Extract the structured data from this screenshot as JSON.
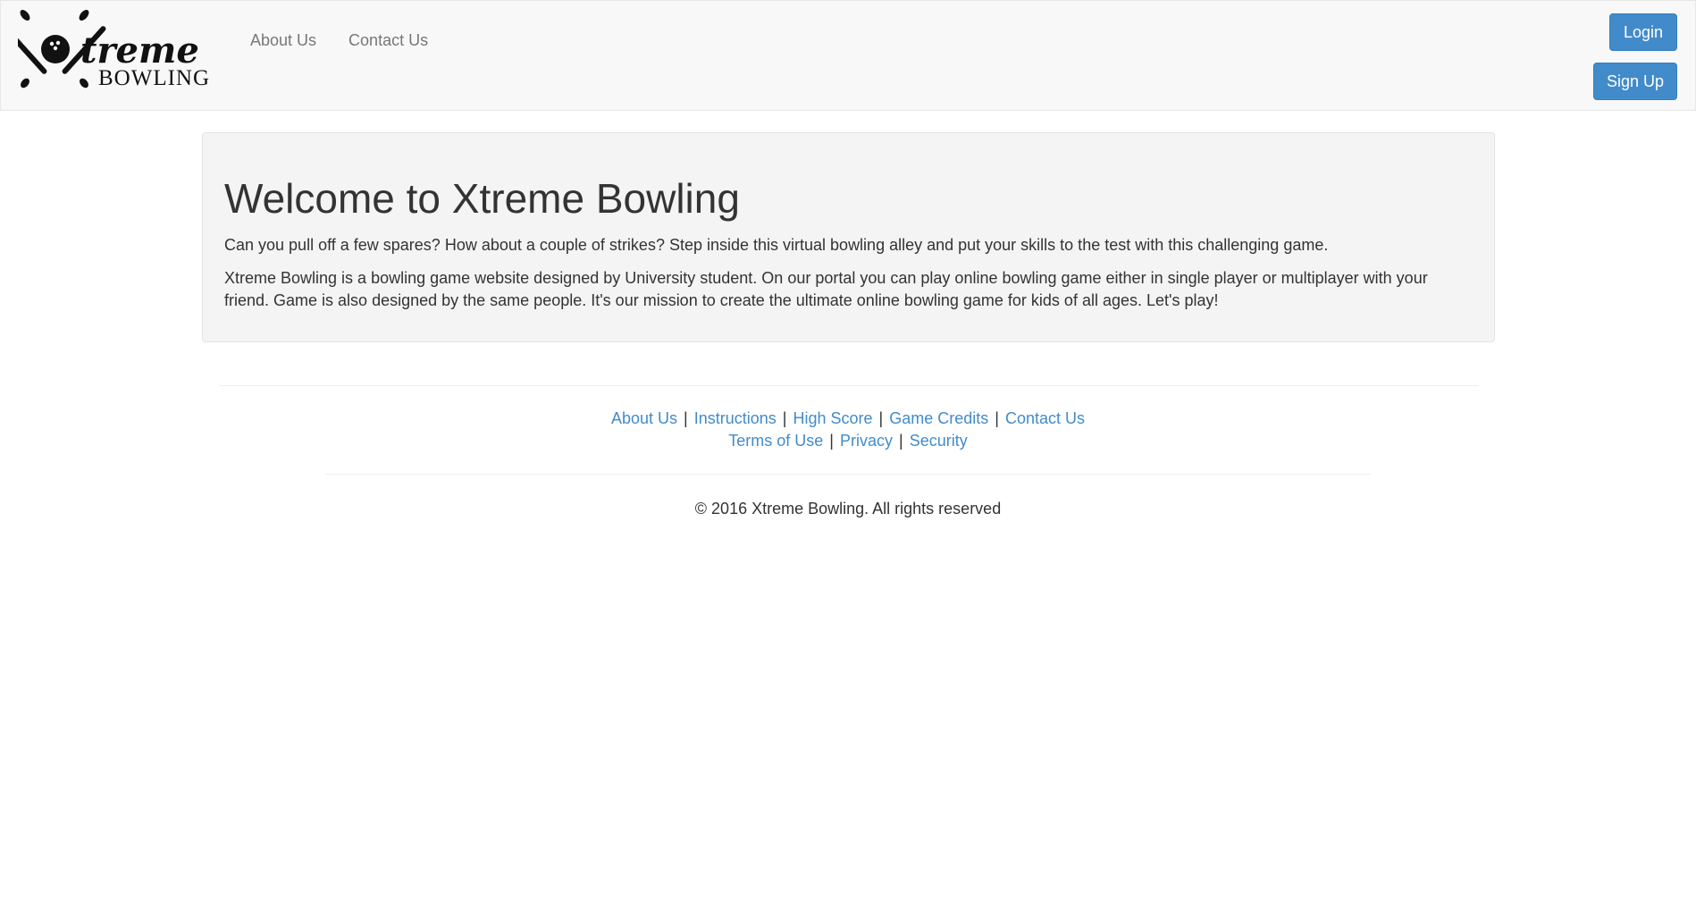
{
  "brand": {
    "logo_top": "treme",
    "logo_x": "X",
    "logo_bottom": "BOWLING"
  },
  "nav": {
    "links": [
      "About Us",
      "Contact Us"
    ],
    "login_label": "Login",
    "signup_label": "Sign Up"
  },
  "jumbotron": {
    "title": "Welcome to Xtreme Bowling",
    "paragraph1": "Can you pull off a few spares? How about a couple of strikes? Step inside this virtual bowling alley and put your skills to the test with this challenging game.",
    "paragraph2": "Xtreme Bowling is a bowling game website designed by University student. On our portal you can play online bowling game either in single player or multiplayer with your friend. Game is also designed by the same people. It's our mission to create the ultimate online bowling game for kids of all ages. Let's play!"
  },
  "footer": {
    "row1": [
      "About Us",
      "Instructions",
      "High Score",
      "Game Credits",
      "Contact Us"
    ],
    "row2": [
      "Terms of Use",
      "Privacy",
      "Security"
    ],
    "separator": "|",
    "copyright": "© 2016 Xtreme Bowling. All rights reserved"
  },
  "colors": {
    "accent": "#428bca",
    "navbar_bg": "#f8f8f8",
    "jumbotron_bg": "#f4f4f4"
  }
}
